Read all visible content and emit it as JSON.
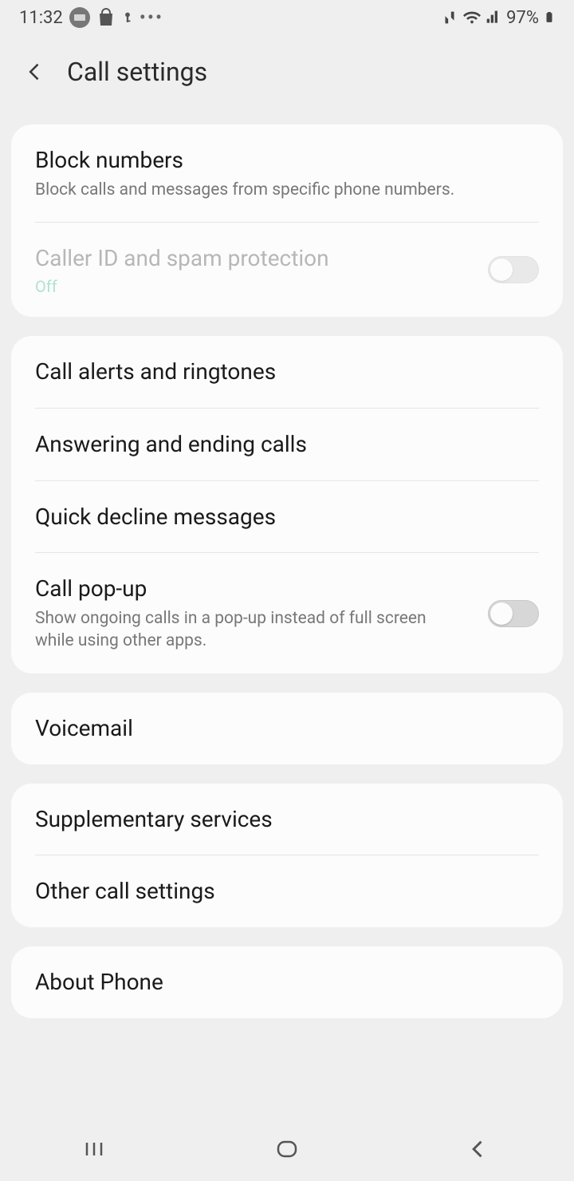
{
  "status": {
    "time": "11:32",
    "battery": "97%"
  },
  "header": {
    "title": "Call settings"
  },
  "groups": [
    {
      "items": [
        {
          "id": "block-numbers",
          "title": "Block numbers",
          "sub": "Block calls and messages from specific phone numbers."
        },
        {
          "id": "caller-id-spam",
          "title": "Caller ID and spam protection",
          "status": "Off",
          "toggle": false,
          "disabled": true
        }
      ]
    },
    {
      "items": [
        {
          "id": "call-alerts",
          "title": "Call alerts and ringtones"
        },
        {
          "id": "answering-ending",
          "title": "Answering and ending calls"
        },
        {
          "id": "quick-decline",
          "title": "Quick decline messages"
        },
        {
          "id": "call-popup",
          "title": "Call pop-up",
          "sub": "Show ongoing calls in a pop-up instead of full screen while using other apps.",
          "toggle": false
        }
      ]
    },
    {
      "items": [
        {
          "id": "voicemail",
          "title": "Voicemail"
        }
      ]
    },
    {
      "items": [
        {
          "id": "supplementary",
          "title": "Supplementary services"
        },
        {
          "id": "other-call-settings",
          "title": "Other call settings"
        }
      ]
    },
    {
      "items": [
        {
          "id": "about-phone",
          "title": "About Phone"
        }
      ]
    }
  ]
}
